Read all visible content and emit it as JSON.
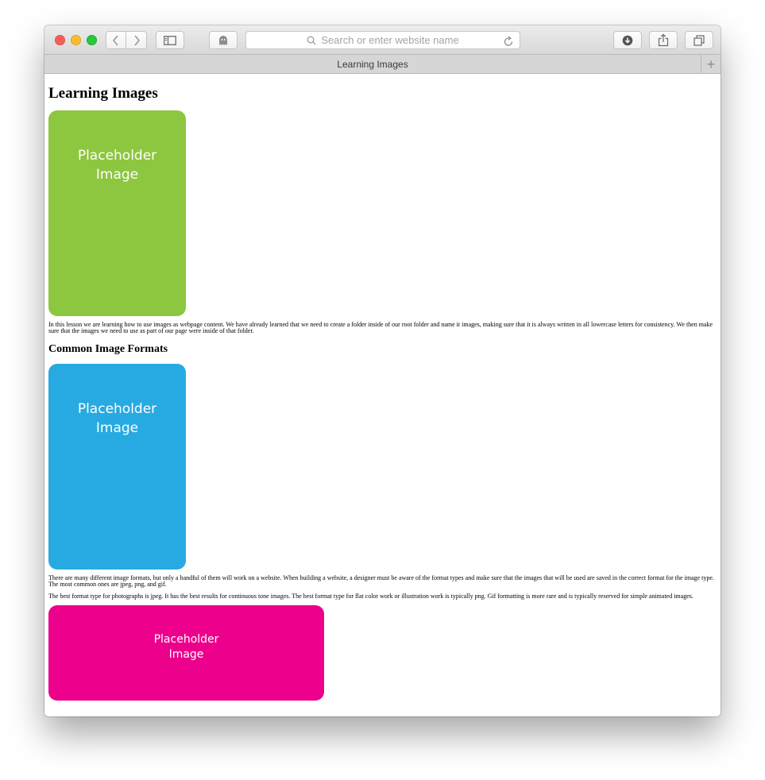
{
  "browser": {
    "address_placeholder": "Search or enter website name",
    "tab_title": "Learning Images",
    "new_tab_glyph": "+",
    "icons": {
      "back": "chevron-left-icon",
      "forward": "chevron-right-icon",
      "sidebar": "sidebar-icon",
      "privacy": "ghost-icon",
      "search": "search-icon",
      "reload": "reload-icon",
      "download": "download-icon",
      "share": "share-icon",
      "tabs": "tabs-overview-icon"
    }
  },
  "page": {
    "title": "Learning Images",
    "image1_label": "Placeholder\nImage",
    "paragraph1": "In this lesson we are learning how to use images as webpage content. We have already learned that we need to create a folder inside of our root folder and name it images, making sure that it is always written in all lowercase letters for consistency. We then make sure that the images we need to use as part of our page were inside of that folder.",
    "subtitle": "Common Image Formats",
    "image2_label": "Placeholder\nImage",
    "paragraph2": "There are many different image formats, but only a handful of them will work on a website. When building a website, a designer must be aware of the format types and make sure that the images that will be used are saved in the correct format for the image type. The most common ones are jpeg, png, and gif.",
    "paragraph3": "The best format type for photographs is jpeg. It has the best results for continuous tone images. The best format type for flat color work or illustration work is typically png. Gif formatting is more rare and is typically reserved for simple animated images.",
    "image3_label": "Placeholder\nImage"
  },
  "colors": {
    "placeholder_green": "#8dc63f",
    "placeholder_blue": "#27aae1",
    "placeholder_pink": "#ec008c"
  }
}
